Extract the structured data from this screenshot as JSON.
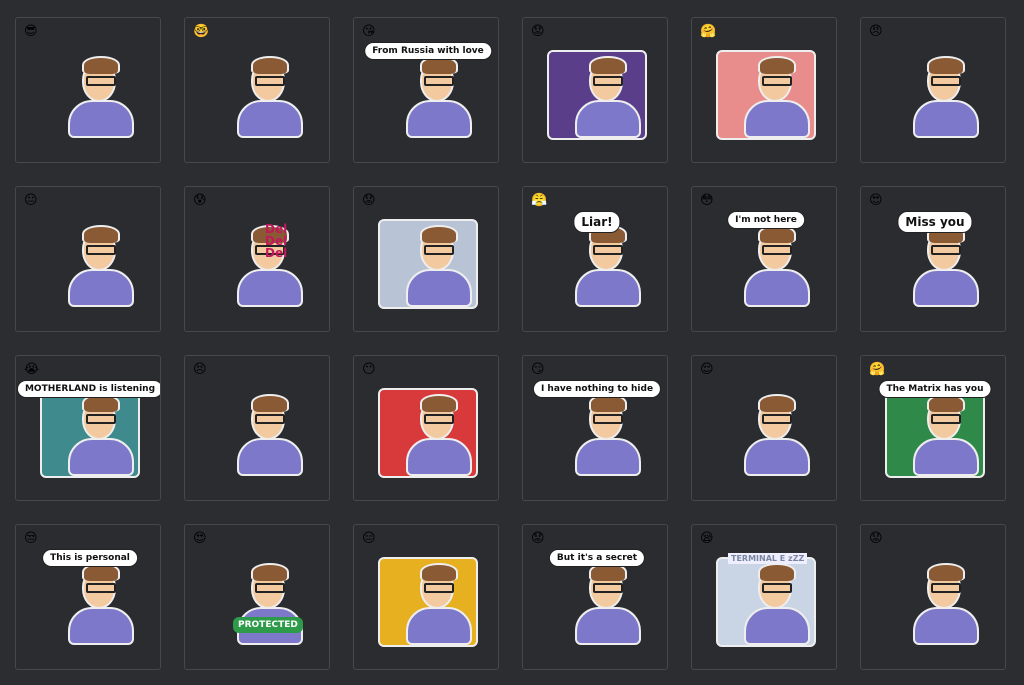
{
  "stickers": [
    {
      "emoji": "😎",
      "scene": "",
      "caption": "",
      "extra": ""
    },
    {
      "emoji": "🤓",
      "scene": "",
      "caption": "",
      "extra": ""
    },
    {
      "emoji": "😘",
      "scene": "",
      "caption": "From Russia with love",
      "extra": ""
    },
    {
      "emoji": "😟",
      "scene": "#5a3e8a",
      "caption": "",
      "extra": ""
    },
    {
      "emoji": "🤗",
      "scene": "#e88c8c",
      "caption": "",
      "extra": ""
    },
    {
      "emoji": "😠",
      "scene": "",
      "caption": "",
      "extra": ""
    },
    {
      "emoji": "😐",
      "scene": "",
      "caption": "",
      "extra": ""
    },
    {
      "emoji": "😰",
      "scene": "",
      "caption": "",
      "extra": "Del Del Del"
    },
    {
      "emoji": "😟",
      "scene": "#b9c3d6",
      "caption": "",
      "extra": ""
    },
    {
      "emoji": "😤",
      "scene": "",
      "caption": "Liar!",
      "extra": ""
    },
    {
      "emoji": "😳",
      "scene": "",
      "caption": "I'm not here",
      "extra": ""
    },
    {
      "emoji": "😍",
      "scene": "",
      "caption": "Miss you",
      "extra": ""
    },
    {
      "emoji": "😭",
      "scene": "#3e8a8c",
      "caption": "MOTHERLAND is listening",
      "extra": ""
    },
    {
      "emoji": "😣",
      "scene": "",
      "caption": "",
      "extra": ""
    },
    {
      "emoji": "😶",
      "scene": "#d8393a",
      "caption": "",
      "extra": ""
    },
    {
      "emoji": "😏",
      "scene": "",
      "caption": "I have nothing to hide",
      "extra": ""
    },
    {
      "emoji": "😌",
      "scene": "",
      "caption": "",
      "extra": ""
    },
    {
      "emoji": "🤗",
      "scene": "#2f8a4a",
      "caption": "The Matrix has you",
      "extra": ""
    },
    {
      "emoji": "😒",
      "scene": "",
      "caption": "This is personal",
      "extra": ""
    },
    {
      "emoji": "😍",
      "scene": "",
      "caption": "",
      "extra": "PROTECTED"
    },
    {
      "emoji": "😑",
      "scene": "#e6b020",
      "caption": "",
      "extra": ""
    },
    {
      "emoji": "😟",
      "scene": "",
      "caption": "But it's a secret",
      "extra": ""
    },
    {
      "emoji": "😪",
      "scene": "#c9d4e4",
      "caption": "",
      "extra": "TERMINAL E  zZZ"
    },
    {
      "emoji": "😟",
      "scene": "",
      "caption": "",
      "extra": ""
    }
  ]
}
